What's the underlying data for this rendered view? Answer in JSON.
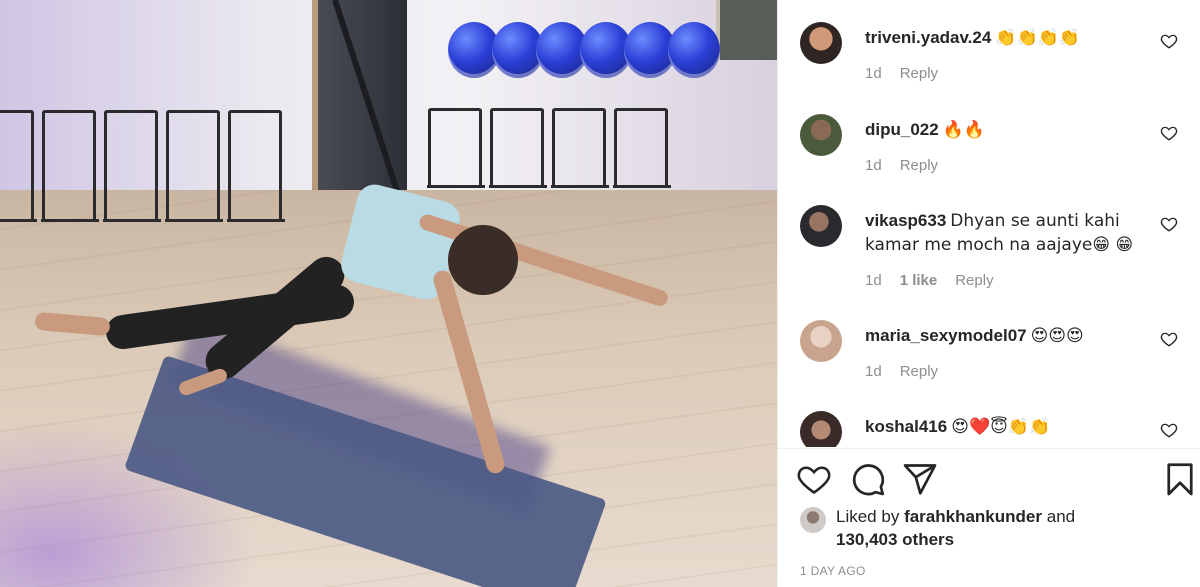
{
  "comments": [
    {
      "username": "triveni.yadav.24",
      "text": "👏👏👏👏",
      "time": "1d",
      "likes": "",
      "reply": "Reply"
    },
    {
      "username": "dipu_022",
      "text": "🔥🔥",
      "time": "1d",
      "likes": "",
      "reply": "Reply"
    },
    {
      "username": "vikasp633",
      "text": "Dhyan se aunti kahi kamar me moch na aajaye😁 😁",
      "time": "1d",
      "likes": "1 like",
      "reply": "Reply"
    },
    {
      "username": "maria_sexymodel07",
      "text": "😍😍😍",
      "time": "1d",
      "likes": "",
      "reply": "Reply"
    },
    {
      "username": "koshal416",
      "text": "😍❤️😇👏👏",
      "time": "",
      "likes": "",
      "reply": ""
    }
  ],
  "likes": {
    "prefix": "Liked by",
    "user": "farahkhankunder",
    "and": "and",
    "count": "130,403 others"
  },
  "date": "1 DAY AGO",
  "icons": {
    "like": "heart-icon",
    "comment": "comment-icon",
    "share": "send-icon",
    "save": "bookmark-icon"
  },
  "colors": {
    "meta": "#8e8e8e",
    "text": "#262626"
  }
}
